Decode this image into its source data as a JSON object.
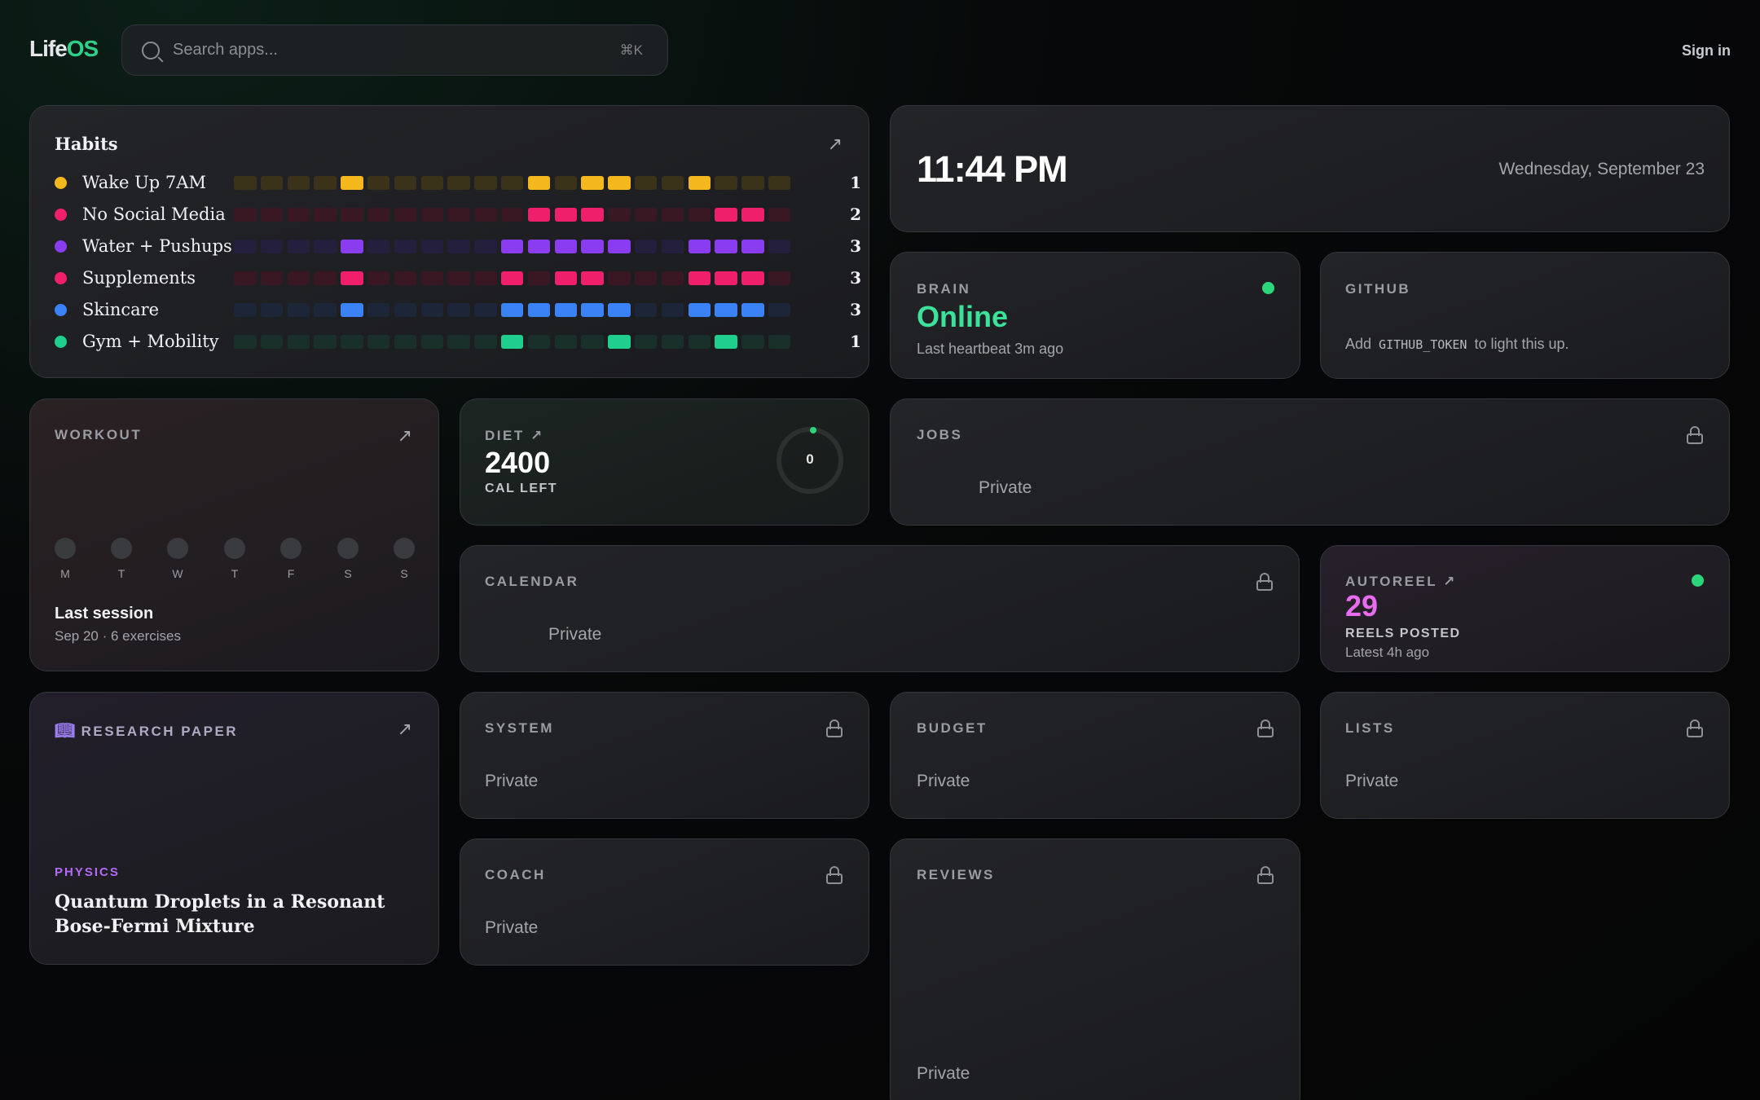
{
  "header": {
    "logo_a": "Life",
    "logo_b": "OS",
    "search_placeholder": "Search apps...",
    "shortcut": "⌘K",
    "sign_in": "Sign in"
  },
  "habits": {
    "title": "Habits",
    "items": [
      {
        "name": "Wake Up 7AM",
        "count": "1",
        "color": "#f5b81c",
        "dim": "#3a3219",
        "done": [
          4,
          11,
          13,
          14,
          17
        ]
      },
      {
        "name": "No Social Media",
        "count": "2",
        "color": "#ef1f6c",
        "dim": "#3a1823",
        "done": [
          11,
          12,
          13,
          18,
          19
        ]
      },
      {
        "name": "Water + Pushups",
        "count": "3",
        "color": "#8a3df0",
        "dim": "#241f3c",
        "done": [
          4,
          10,
          11,
          12,
          13,
          14,
          17,
          18,
          19
        ]
      },
      {
        "name": "Supplements",
        "count": "3",
        "color": "#ef1f6c",
        "dim": "#3a1823",
        "done": [
          4,
          10,
          12,
          13,
          17,
          18,
          19
        ]
      },
      {
        "name": "Skincare",
        "count": "3",
        "color": "#3b82f6",
        "dim": "#1d2538",
        "done": [
          4,
          10,
          11,
          12,
          13,
          14,
          17,
          18,
          19
        ]
      },
      {
        "name": "Gym + Mobility",
        "count": "1",
        "color": "#1fcf8e",
        "dim": "#183029",
        "done": [
          10,
          14,
          18
        ]
      }
    ]
  },
  "clock": {
    "time": "11:44 PM",
    "date": "Wednesday, September 23"
  },
  "brain": {
    "label": "BRAIN",
    "status": "Online",
    "sub": "Last heartbeat 3m ago"
  },
  "github": {
    "label": "GITHUB",
    "pre": "Add",
    "code": "GITHUB_TOKEN",
    "post": "to light this up."
  },
  "workout": {
    "label": "WORKOUT",
    "days": [
      "M",
      "T",
      "W",
      "T",
      "F",
      "S",
      "S"
    ],
    "title": "Last session",
    "sub": "Sep 20 · 6 exercises"
  },
  "diet": {
    "label": "DIET",
    "value": "2400",
    "unit": "CAL LEFT",
    "ring": "0"
  },
  "jobs": {
    "label": "JOBS",
    "status": "Private"
  },
  "calendar": {
    "label": "CALENDAR",
    "status": "Private"
  },
  "autoreel": {
    "label": "AUTOREEL",
    "value": "29",
    "unit": "REELS POSTED",
    "sub": "Latest 4h ago"
  },
  "research": {
    "label": "RESEARCH PAPER",
    "tag": "PHYSICS",
    "title": "Quantum Droplets in a Resonant Bose-Fermi Mixture"
  },
  "system": {
    "label": "SYSTEM",
    "status": "Private"
  },
  "budget": {
    "label": "BUDGET",
    "status": "Private"
  },
  "lists": {
    "label": "LISTS",
    "status": "Private"
  },
  "coach": {
    "label": "COACH",
    "status": "Private"
  },
  "reviews": {
    "label": "REVIEWS",
    "status": "Private"
  }
}
